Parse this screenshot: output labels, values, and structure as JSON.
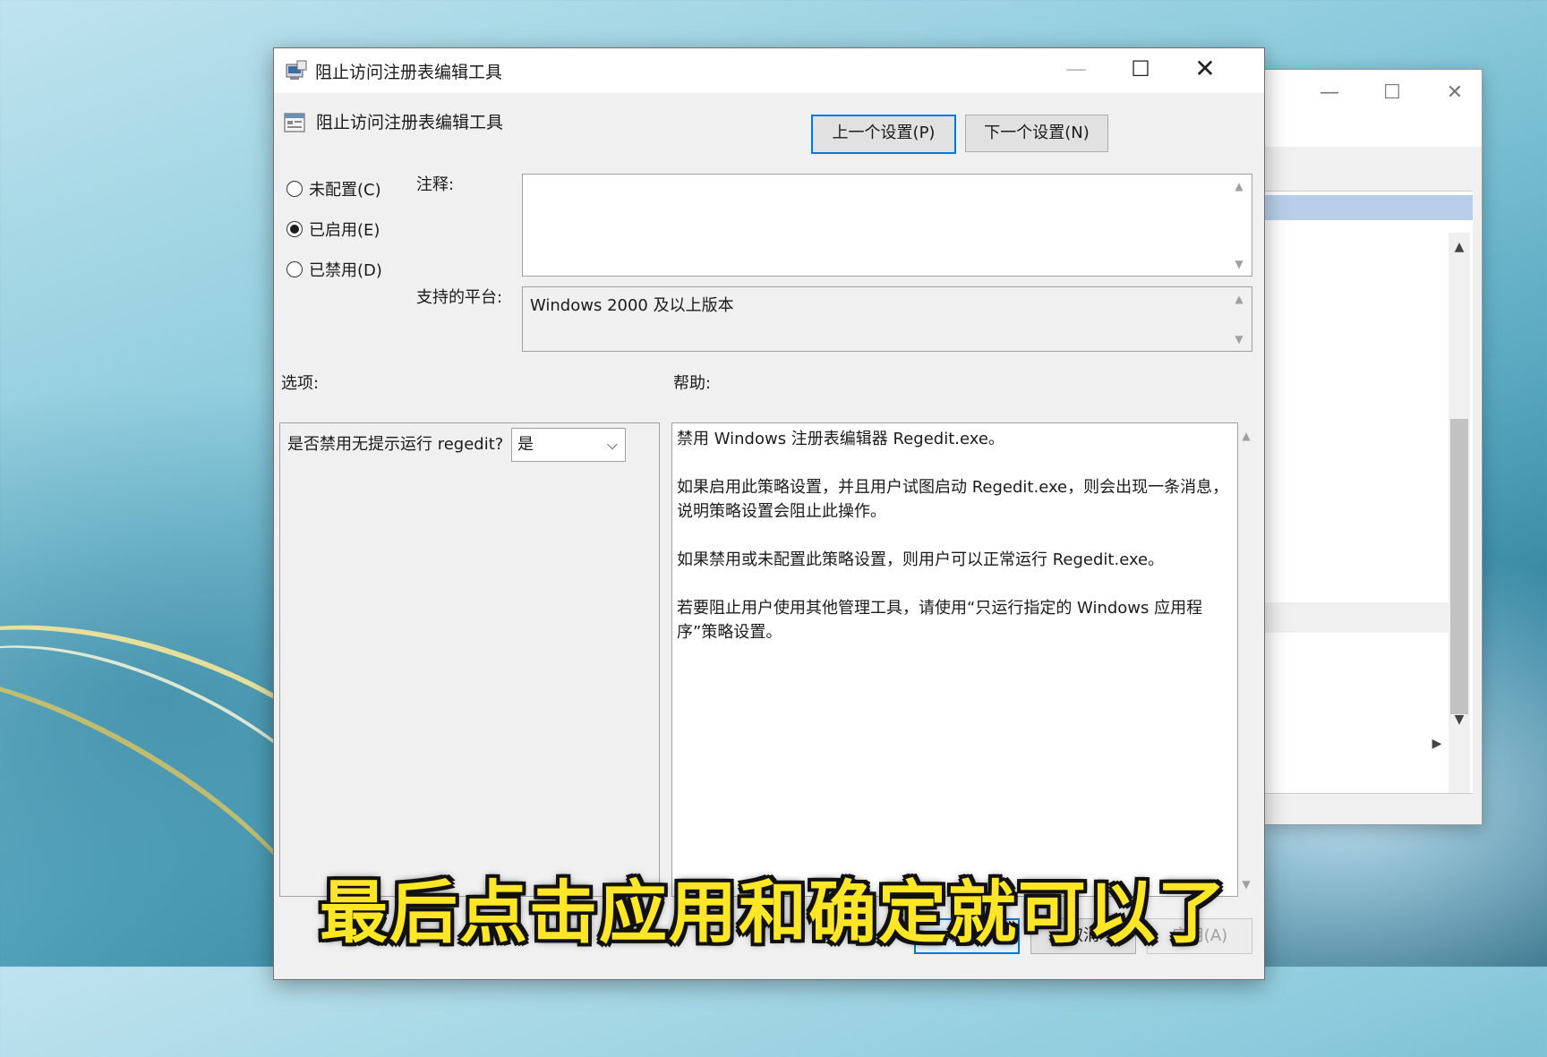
{
  "dialog": {
    "title": "阻止访问注册表编辑工具",
    "header_title": "阻止访问注册表编辑工具",
    "prev_button": "上一个设置(P)",
    "next_button": "下一个设置(N)",
    "radios": [
      {
        "label": "未配置(C)",
        "selected": false
      },
      {
        "label": "已启用(E)",
        "selected": true
      },
      {
        "label": "已禁用(D)",
        "selected": false
      }
    ],
    "comment_label": "注释:",
    "comment_value": "",
    "platform_label": "支持的平台:",
    "platform_value": "Windows 2000 及以上版本",
    "options_label": "选项:",
    "help_label": "帮助:",
    "option_question": "是否禁用无提示运行 regedit?",
    "option_value": "是",
    "help_paragraphs": [
      "禁用 Windows 注册表编辑器 Regedit.exe。",
      "如果启用此策略设置，并且用户试图启动 Regedit.exe，则会出现一条消息，说明策略设置会阻止此操作。",
      "如果禁用或未配置此策略设置，则用户可以正常运行 Regedit.exe。",
      "若要阻止用户使用其他管理工具，请使用“只运行指定的 Windows 应用程序”策略设置。"
    ],
    "ok_button": "确定",
    "cancel_button": "取消",
    "apply_button": "应用(A)"
  },
  "caption": "最后点击应用和确定就可以了",
  "colors": {
    "accent": "#0078d7",
    "caption": "#ffe626"
  }
}
